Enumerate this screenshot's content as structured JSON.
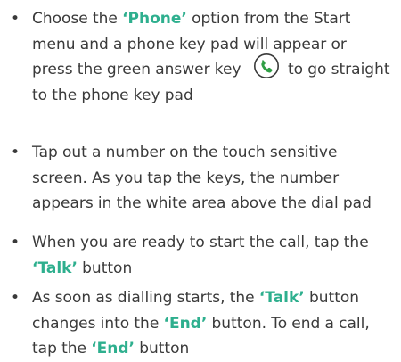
{
  "items": [
    {
      "parts": [
        {
          "t": "Choose the "
        },
        {
          "t": "‘Phone’",
          "em": true
        },
        {
          "t": " option from the Start menu and a phone key pad will appear or press the green answer key "
        },
        {
          "icon": "green-answer-key-icon"
        },
        {
          "t": " to go straight to the phone key pad"
        }
      ]
    },
    {
      "parts": [
        {
          "t": "Tap out a number on the touch sensitive screen. As you tap the keys, the number appears in the white area above the dial pad"
        }
      ]
    },
    {
      "parts": [
        {
          "t": "When you are ready to start the call, tap the "
        },
        {
          "t": "‘Talk’",
          "em": true
        },
        {
          "t": " button"
        }
      ]
    },
    {
      "parts": [
        {
          "t": "As soon as dialling starts, the "
        },
        {
          "t": "‘Talk’",
          "em": true
        },
        {
          "t": " button changes into the "
        },
        {
          "t": "‘End’",
          "em": true
        },
        {
          "t": " button. To end a call, tap the "
        },
        {
          "t": "‘End’",
          "em": true
        },
        {
          "t": " button"
        }
      ]
    }
  ],
  "colors": {
    "text": "#3a3a3a",
    "emphasis": "#2eaf8e",
    "icon_green": "#2f9e44"
  }
}
